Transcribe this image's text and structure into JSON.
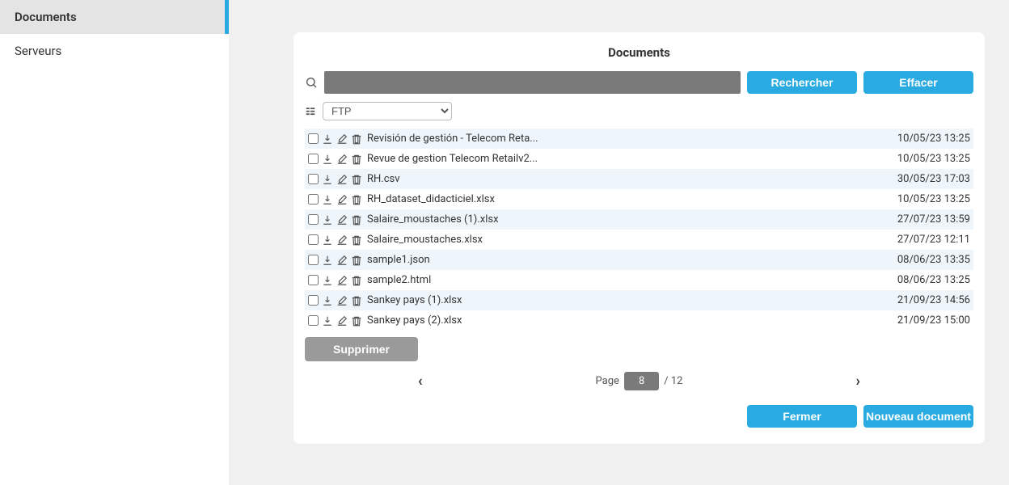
{
  "sidebar": {
    "items": [
      {
        "label": "Documents",
        "active": true
      },
      {
        "label": "Serveurs",
        "active": false
      }
    ]
  },
  "panel": {
    "title": "Documents"
  },
  "search": {
    "value": "",
    "search_btn": "Rechercher",
    "clear_btn": "Effacer"
  },
  "server_select": {
    "selected": "FTP"
  },
  "documents": [
    {
      "name": "Revisión de gestión - Telecom Reta...",
      "date": "10/05/23 13:25"
    },
    {
      "name": "Revue de gestion Telecom Retailv2...",
      "date": "10/05/23 13:25"
    },
    {
      "name": "RH.csv",
      "date": "30/05/23 17:03"
    },
    {
      "name": "RH_dataset_didacticiel.xlsx",
      "date": "10/05/23 13:25"
    },
    {
      "name": "Salaire_moustaches (1).xlsx",
      "date": "27/07/23 13:59"
    },
    {
      "name": "Salaire_moustaches.xlsx",
      "date": "27/07/23 12:11"
    },
    {
      "name": "sample1.json",
      "date": "08/06/23 13:35"
    },
    {
      "name": "sample2.html",
      "date": "08/06/23 13:25"
    },
    {
      "name": "Sankey pays (1).xlsx",
      "date": "21/09/23 14:56"
    },
    {
      "name": "Sankey pays (2).xlsx",
      "date": "21/09/23 15:00"
    }
  ],
  "delete_btn": "Supprimer",
  "pagination": {
    "label": "Page",
    "current": "8",
    "total": "/ 12"
  },
  "footer": {
    "close": "Fermer",
    "new_doc": "Nouveau document"
  }
}
